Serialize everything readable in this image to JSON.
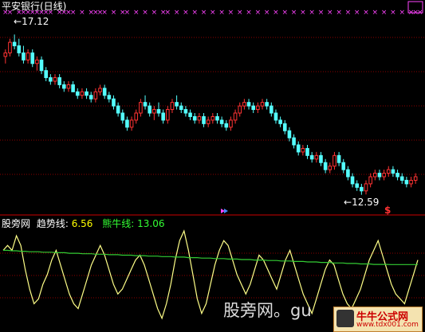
{
  "colors": {
    "background": "#000000",
    "up": "#ff3333",
    "down": "#54ffff",
    "grid": "#8b0000",
    "marker": "#ff44ff",
    "trend_line": "#ffff88",
    "bull_bear_line": "#33cc33",
    "label_white": "#ffffff",
    "label_yellow": "#ffff00",
    "label_green": "#33ff33"
  },
  "price_panel": {
    "title": "平安银行(日线)",
    "high_label": "17.12",
    "low_label": "12.59",
    "signal_icon": "dollar-sign-icon"
  },
  "indicator_panel": {
    "name": "股旁网",
    "trend_label": "趋势线:",
    "trend_value": "6.56",
    "bullbear_label": "熊牛线:",
    "bullbear_value": "13.06"
  },
  "watermark": {
    "text": "股旁网。gu",
    "brand_name": "牛牛公式网",
    "brand_url": "www.tdx001.com"
  },
  "chart_data": [
    {
      "type": "candlestick",
      "title": "平安银行(日线)",
      "ylim": [
        12.2,
        17.6
      ],
      "annotations": [
        {
          "text": "17.12",
          "value": 17.12
        },
        {
          "text": "12.59",
          "value": 12.59
        }
      ],
      "candles": [
        [
          16.5,
          16.7,
          16.3,
          16.6
        ],
        [
          16.6,
          17.0,
          16.5,
          16.9
        ],
        [
          16.9,
          17.12,
          16.7,
          16.8
        ],
        [
          16.8,
          17.0,
          16.5,
          16.6
        ],
        [
          16.6,
          16.8,
          16.3,
          16.4
        ],
        [
          16.4,
          16.7,
          16.3,
          16.6
        ],
        [
          16.6,
          16.7,
          16.2,
          16.3
        ],
        [
          16.3,
          16.5,
          16.1,
          16.4
        ],
        [
          16.4,
          16.5,
          16.0,
          16.1
        ],
        [
          16.1,
          16.2,
          15.8,
          15.9
        ],
        [
          15.9,
          16.0,
          15.7,
          15.8
        ],
        [
          15.8,
          16.0,
          15.7,
          15.9
        ],
        [
          15.9,
          16.0,
          15.6,
          15.7
        ],
        [
          15.7,
          15.8,
          15.5,
          15.6
        ],
        [
          15.6,
          15.8,
          15.5,
          15.7
        ],
        [
          15.7,
          15.8,
          15.5,
          15.5
        ],
        [
          15.5,
          15.6,
          15.3,
          15.4
        ],
        [
          15.4,
          15.6,
          15.3,
          15.5
        ],
        [
          15.5,
          15.6,
          15.3,
          15.4
        ],
        [
          15.4,
          15.5,
          15.2,
          15.3
        ],
        [
          15.3,
          15.6,
          15.2,
          15.5
        ],
        [
          15.5,
          15.7,
          15.4,
          15.6
        ],
        [
          15.6,
          15.7,
          15.3,
          15.4
        ],
        [
          15.4,
          15.5,
          15.2,
          15.3
        ],
        [
          15.3,
          15.4,
          15.0,
          15.1
        ],
        [
          15.1,
          15.2,
          14.8,
          14.9
        ],
        [
          14.9,
          15.0,
          14.6,
          14.7
        ],
        [
          14.7,
          14.8,
          14.4,
          14.5
        ],
        [
          14.5,
          14.8,
          14.4,
          14.7
        ],
        [
          14.7,
          15.0,
          14.6,
          14.9
        ],
        [
          14.9,
          15.3,
          14.8,
          15.2
        ],
        [
          15.2,
          15.4,
          15.0,
          15.1
        ],
        [
          15.1,
          15.2,
          14.8,
          14.9
        ],
        [
          14.9,
          15.1,
          14.7,
          15.0
        ],
        [
          15.0,
          15.2,
          14.8,
          14.9
        ],
        [
          14.9,
          15.0,
          14.6,
          14.7
        ],
        [
          14.7,
          15.1,
          14.6,
          15.0
        ],
        [
          15.0,
          15.3,
          14.9,
          15.2
        ],
        [
          15.2,
          15.4,
          15.0,
          15.1
        ],
        [
          15.1,
          15.2,
          14.9,
          15.0
        ],
        [
          15.0,
          15.1,
          14.8,
          14.9
        ],
        [
          14.9,
          15.0,
          14.7,
          14.8
        ],
        [
          14.8,
          14.9,
          14.6,
          14.7
        ],
        [
          14.7,
          14.9,
          14.6,
          14.8
        ],
        [
          14.8,
          14.9,
          14.5,
          14.6
        ],
        [
          14.6,
          14.8,
          14.5,
          14.7
        ],
        [
          14.7,
          14.9,
          14.6,
          14.8
        ],
        [
          14.8,
          14.9,
          14.6,
          14.7
        ],
        [
          14.7,
          14.8,
          14.5,
          14.6
        ],
        [
          14.6,
          14.7,
          14.4,
          14.5
        ],
        [
          14.5,
          14.8,
          14.4,
          14.7
        ],
        [
          14.7,
          15.0,
          14.6,
          14.9
        ],
        [
          14.9,
          15.2,
          14.8,
          15.1
        ],
        [
          15.1,
          15.3,
          15.0,
          15.2
        ],
        [
          15.2,
          15.3,
          15.0,
          15.1
        ],
        [
          15.1,
          15.2,
          14.9,
          15.0
        ],
        [
          15.0,
          15.2,
          14.9,
          15.1
        ],
        [
          15.1,
          15.3,
          15.0,
          15.2
        ],
        [
          15.2,
          15.3,
          15.0,
          15.1
        ],
        [
          15.1,
          15.2,
          14.8,
          14.9
        ],
        [
          14.9,
          15.0,
          14.6,
          14.7
        ],
        [
          14.7,
          14.8,
          14.5,
          14.6
        ],
        [
          14.6,
          14.7,
          14.3,
          14.4
        ],
        [
          14.4,
          14.5,
          14.1,
          14.2
        ],
        [
          14.2,
          14.3,
          13.9,
          14.0
        ],
        [
          14.0,
          14.1,
          13.7,
          13.8
        ],
        [
          13.8,
          14.0,
          13.7,
          13.9
        ],
        [
          13.9,
          14.0,
          13.6,
          13.7
        ],
        [
          13.7,
          13.8,
          13.5,
          13.6
        ],
        [
          13.6,
          13.8,
          13.5,
          13.7
        ],
        [
          13.7,
          13.8,
          13.4,
          13.5
        ],
        [
          13.5,
          13.6,
          13.2,
          13.3
        ],
        [
          13.3,
          13.5,
          13.2,
          13.4
        ],
        [
          13.4,
          13.8,
          13.3,
          13.7
        ],
        [
          13.7,
          13.8,
          13.4,
          13.5
        ],
        [
          13.5,
          13.6,
          13.2,
          13.3
        ],
        [
          13.3,
          13.4,
          13.0,
          13.1
        ],
        [
          13.1,
          13.2,
          12.8,
          12.9
        ],
        [
          12.9,
          13.0,
          12.7,
          12.8
        ],
        [
          12.8,
          12.9,
          12.59,
          12.7
        ],
        [
          12.7,
          13.0,
          12.6,
          12.9
        ],
        [
          12.9,
          13.2,
          12.8,
          13.1
        ],
        [
          13.1,
          13.3,
          13.0,
          13.2
        ],
        [
          13.2,
          13.3,
          13.0,
          13.1
        ],
        [
          13.1,
          13.3,
          13.0,
          13.2
        ],
        [
          13.2,
          13.4,
          13.1,
          13.3
        ],
        [
          13.3,
          13.4,
          13.1,
          13.2
        ],
        [
          13.2,
          13.3,
          13.0,
          13.1
        ],
        [
          13.1,
          13.2,
          12.9,
          13.0
        ],
        [
          13.0,
          13.1,
          12.8,
          12.9
        ],
        [
          12.9,
          13.1,
          12.8,
          13.0
        ],
        [
          13.0,
          13.2,
          12.9,
          13.1
        ]
      ],
      "signal_markers_index": [
        0,
        1,
        3,
        4,
        5,
        6,
        7,
        8,
        9,
        10,
        12,
        13,
        14,
        15,
        17,
        19,
        20,
        21,
        22,
        24,
        26,
        27,
        29,
        31,
        33,
        35,
        36,
        38,
        40,
        42,
        44,
        46,
        48,
        50,
        52,
        54,
        56,
        58,
        60,
        62,
        64,
        66,
        68,
        70,
        72,
        74,
        76,
        78,
        80,
        82,
        84,
        86,
        88,
        90,
        91,
        92
      ]
    },
    {
      "type": "line",
      "title": "股旁网",
      "ylim": [
        0,
        20
      ],
      "series": [
        {
          "name": "趋势线",
          "values": [
            16,
            17,
            16,
            19,
            17,
            12,
            8,
            5,
            6,
            9,
            11,
            14,
            16,
            13,
            10,
            7,
            5,
            4,
            7,
            10,
            13,
            15,
            17,
            15,
            12,
            9,
            7,
            8,
            10,
            12,
            14,
            15,
            13,
            10,
            7,
            4,
            2,
            5,
            9,
            14,
            18,
            20,
            16,
            11,
            6,
            3,
            5,
            9,
            13,
            16,
            18,
            17,
            14,
            11,
            9,
            7,
            9,
            12,
            15,
            14,
            12,
            10,
            8,
            11,
            14,
            16,
            13,
            10,
            7,
            5,
            3,
            6,
            9,
            12,
            14,
            13,
            10,
            7,
            5,
            4,
            6,
            8,
            11,
            14,
            16,
            18,
            15,
            12,
            9,
            7,
            6,
            5,
            8,
            11,
            14
          ],
          "last": 6.56
        },
        {
          "name": "熊牛线",
          "values": [
            16,
            16,
            15.9,
            15.9,
            15.8,
            15.8,
            15.7,
            15.7,
            15.7,
            15.6,
            15.6,
            15.6,
            15.5,
            15.5,
            15.5,
            15.4,
            15.4,
            15.4,
            15.3,
            15.3,
            15.3,
            15.2,
            15.2,
            15.2,
            15.1,
            15.1,
            15.1,
            15,
            15,
            15,
            14.9,
            14.9,
            14.9,
            14.8,
            14.8,
            14.8,
            14.7,
            14.7,
            14.7,
            14.6,
            14.6,
            14.6,
            14.5,
            14.5,
            14.5,
            14.4,
            14.4,
            14.4,
            14.3,
            14.3,
            14.3,
            14.2,
            14.2,
            14.2,
            14.1,
            14.1,
            14.1,
            14,
            14,
            14,
            13.9,
            13.9,
            13.9,
            13.8,
            13.8,
            13.8,
            13.7,
            13.7,
            13.7,
            13.6,
            13.6,
            13.6,
            13.5,
            13.5,
            13.5,
            13.4,
            13.4,
            13.4,
            13.3,
            13.3,
            13.3,
            13.2,
            13.2,
            13.2,
            13.1,
            13.1,
            13.1,
            13.1,
            13.06,
            13.06,
            13.06,
            13.06,
            13.06,
            13.06,
            13.06
          ],
          "last": 13.06
        }
      ]
    }
  ]
}
